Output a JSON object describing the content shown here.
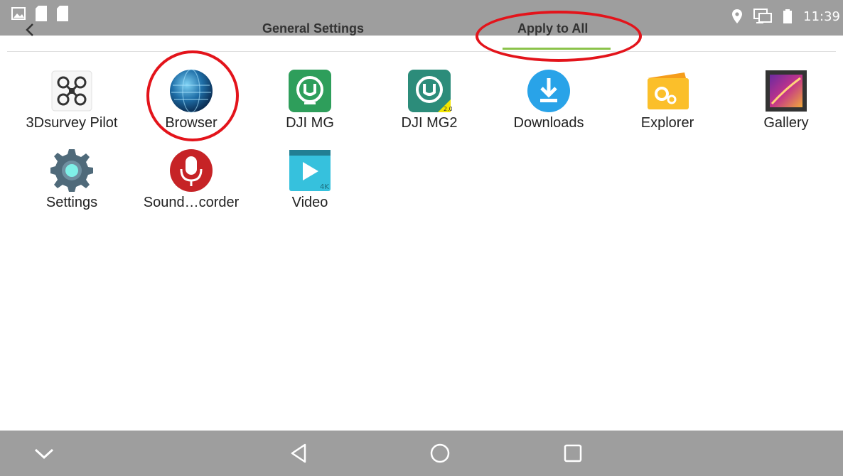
{
  "status_bar": {
    "time": "11:39",
    "icons": [
      "image-icon",
      "sd-card-icon",
      "sd-card-icon",
      "location-icon",
      "screen-cast-icon",
      "battery-icon"
    ]
  },
  "tabs": {
    "general": "General Settings",
    "apply_all": "Apply to All",
    "active": "apply_all"
  },
  "apps": [
    {
      "label": "3Dsurvey Pilot",
      "icon": "drone-icon"
    },
    {
      "label": "Browser",
      "icon": "globe-icon"
    },
    {
      "label": "DJI MG",
      "icon": "dji-mg-icon"
    },
    {
      "label": "DJI MG2",
      "icon": "dji-mg2-icon"
    },
    {
      "label": "Downloads",
      "icon": "download-icon"
    },
    {
      "label": "Explorer",
      "icon": "folder-gear-icon"
    },
    {
      "label": "Gallery",
      "icon": "gallery-icon"
    },
    {
      "label": "Settings",
      "icon": "gear-icon"
    },
    {
      "label": "Sound…corder",
      "icon": "microphone-icon"
    },
    {
      "label": "Video",
      "icon": "video-icon"
    }
  ],
  "nav": {
    "buttons": [
      "chevron-down-icon",
      "back-icon",
      "home-icon",
      "recents-icon"
    ]
  },
  "colors": {
    "bar_gray": "#9e9e9e",
    "tab_indicator": "#8bc34a",
    "annotation_red": "#e3141b"
  }
}
